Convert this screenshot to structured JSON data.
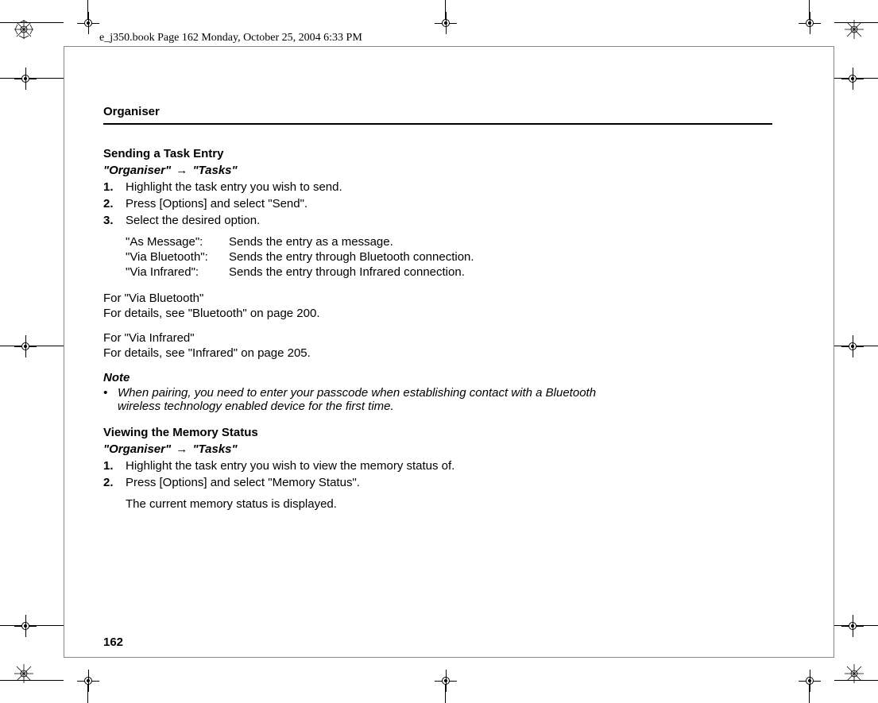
{
  "header_line": "e_j350.book  Page 162  Monday, October 25, 2004  6:33 PM",
  "chapter": "Organiser",
  "page_number": "162",
  "section1": {
    "heading": "Sending a Task Entry",
    "breadcrumb_a": "\"Organiser\"",
    "breadcrumb_b": "\"Tasks\"",
    "steps": [
      "Highlight the task entry you wish to send.",
      "Press [Options] and select \"Send\".",
      "Select the desired option."
    ],
    "options": [
      {
        "key": "\"As Message\":",
        "desc": "Sends the entry as a message."
      },
      {
        "key": "\"Via Bluetooth\":",
        "desc": "Sends the entry through Bluetooth connection."
      },
      {
        "key": "\"Via Infrared\":",
        "desc": "Sends the entry through Infrared connection."
      }
    ],
    "sub1_heading": "For \"Via Bluetooth\"",
    "sub1_text": "For details, see \"Bluetooth\" on page 200.",
    "sub2_heading": "For \"Via Infrared\"",
    "sub2_text": "For details, see \"Infrared\" on page 205."
  },
  "note": {
    "label": "Note",
    "text": "When pairing, you need to enter your passcode when establishing contact with a Bluetooth wireless technology enabled device for the first time."
  },
  "section2": {
    "heading": "Viewing the Memory Status",
    "breadcrumb_a": "\"Organiser\"",
    "breadcrumb_b": "\"Tasks\"",
    "steps": [
      "Highlight the task entry you wish to view the memory status of.",
      "Press [Options] and select \"Memory Status\"."
    ],
    "result": "The current memory status is displayed."
  }
}
